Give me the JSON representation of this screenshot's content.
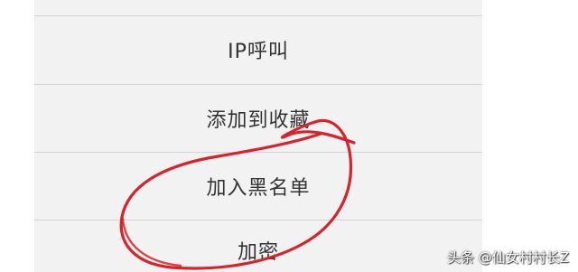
{
  "menu": {
    "items": [
      {
        "label": "IP呼叫"
      },
      {
        "label": "添加到收藏"
      },
      {
        "label": "加入黑名单"
      },
      {
        "label": "加密"
      }
    ]
  },
  "watermark": {
    "text": "头条 @仙女村村长Z"
  },
  "colors": {
    "panel_background": "#f2f2f2",
    "divider": "#d4d4d4",
    "text": "#333333",
    "annotation_stroke": "#d8232a"
  }
}
